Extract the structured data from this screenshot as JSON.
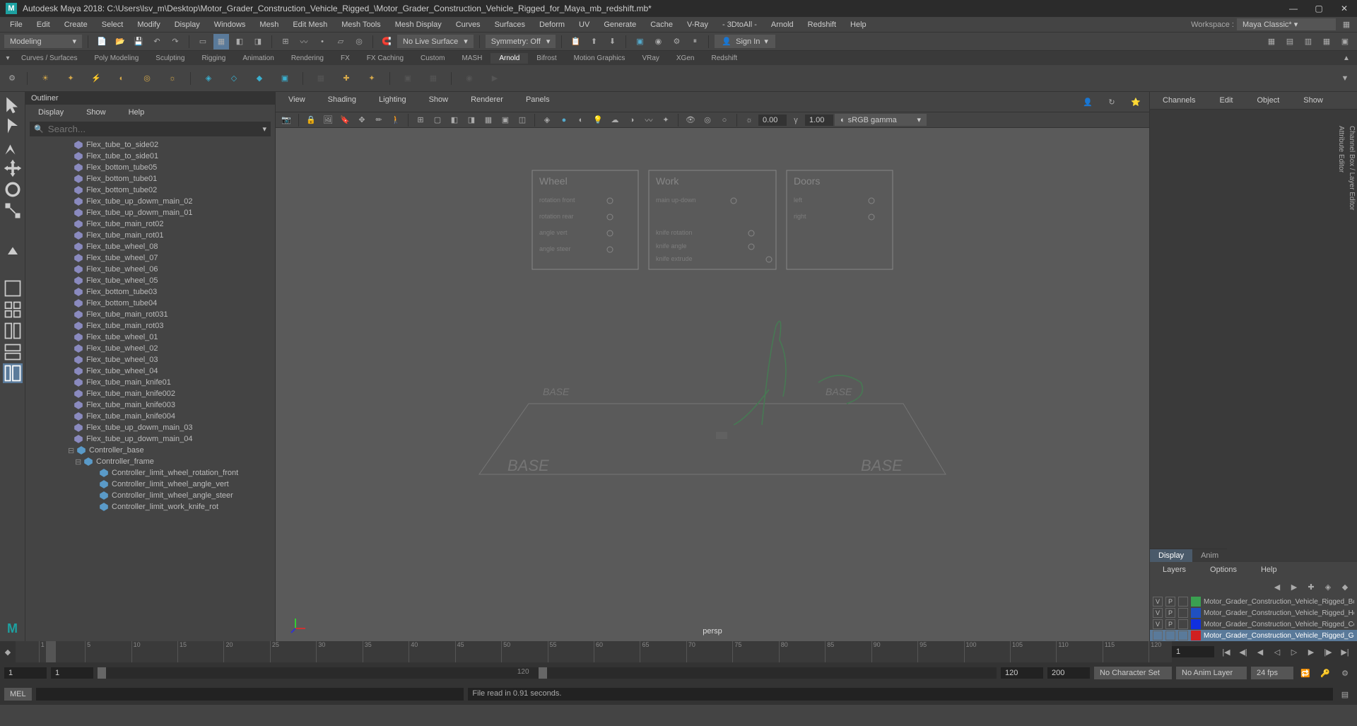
{
  "titlebar": {
    "icon_letter": "M",
    "title": "Autodesk Maya 2018: C:\\Users\\lsv_m\\Desktop\\Motor_Grader_Construction_Vehicle_Rigged_\\Motor_Grader_Construction_Vehicle_Rigged_for_Maya_mb_redshift.mb*"
  },
  "menubar": {
    "items": [
      "File",
      "Edit",
      "Create",
      "Select",
      "Modify",
      "Display",
      "Windows",
      "Mesh",
      "Edit Mesh",
      "Mesh Tools",
      "Mesh Display",
      "Curves",
      "Surfaces",
      "Deform",
      "UV",
      "Generate",
      "Cache",
      "V-Ray",
      "- 3DtoAll -",
      "Arnold",
      "Redshift",
      "Help"
    ],
    "workspace_label": "Workspace :",
    "workspace_value": "Maya Classic*"
  },
  "statusline": {
    "mode": "Modeling",
    "no_live_surface": "No Live Surface",
    "symmetry": "Symmetry: Off",
    "signin": "Sign In"
  },
  "shelf_tabs": [
    "Curves / Surfaces",
    "Poly Modeling",
    "Sculpting",
    "Rigging",
    "Animation",
    "Rendering",
    "FX",
    "FX Caching",
    "Custom",
    "MASH",
    "Arnold",
    "Bifrost",
    "Motion Graphics",
    "VRay",
    "XGen",
    "Redshift"
  ],
  "shelf_tabs_active": "Arnold",
  "outliner": {
    "title": "Outliner",
    "menu": [
      "Display",
      "Show",
      "Help"
    ],
    "search_placeholder": "Search...",
    "items": [
      {
        "name": "Flex_tube_to_side02",
        "indent": 1,
        "icon": "mesh"
      },
      {
        "name": "Flex_tube_to_side01",
        "indent": 1,
        "icon": "mesh"
      },
      {
        "name": "Flex_bottom_tube05",
        "indent": 1,
        "icon": "mesh"
      },
      {
        "name": "Flex_bottom_tube01",
        "indent": 1,
        "icon": "mesh"
      },
      {
        "name": "Flex_bottom_tube02",
        "indent": 1,
        "icon": "mesh"
      },
      {
        "name": "Flex_tube_up_dowm_main_02",
        "indent": 1,
        "icon": "mesh"
      },
      {
        "name": "Flex_tube_up_dowm_main_01",
        "indent": 1,
        "icon": "mesh"
      },
      {
        "name": "Flex_tube_main_rot02",
        "indent": 1,
        "icon": "mesh"
      },
      {
        "name": "Flex_tube_main_rot01",
        "indent": 1,
        "icon": "mesh"
      },
      {
        "name": "Flex_tube_wheel_08",
        "indent": 1,
        "icon": "mesh"
      },
      {
        "name": "Flex_tube_wheel_07",
        "indent": 1,
        "icon": "mesh"
      },
      {
        "name": "Flex_tube_wheel_06",
        "indent": 1,
        "icon": "mesh"
      },
      {
        "name": "Flex_tube_wheel_05",
        "indent": 1,
        "icon": "mesh"
      },
      {
        "name": "Flex_bottom_tube03",
        "indent": 1,
        "icon": "mesh"
      },
      {
        "name": "Flex_bottom_tube04",
        "indent": 1,
        "icon": "mesh"
      },
      {
        "name": "Flex_tube_main_rot031",
        "indent": 1,
        "icon": "mesh"
      },
      {
        "name": "Flex_tube_main_rot03",
        "indent": 1,
        "icon": "mesh"
      },
      {
        "name": "Flex_tube_wheel_01",
        "indent": 1,
        "icon": "mesh"
      },
      {
        "name": "Flex_tube_wheel_02",
        "indent": 1,
        "icon": "mesh"
      },
      {
        "name": "Flex_tube_wheel_03",
        "indent": 1,
        "icon": "mesh"
      },
      {
        "name": "Flex_tube_wheel_04",
        "indent": 1,
        "icon": "mesh"
      },
      {
        "name": "Flex_tube_main_knife01",
        "indent": 1,
        "icon": "mesh"
      },
      {
        "name": "Flex_tube_main_knife002",
        "indent": 1,
        "icon": "mesh"
      },
      {
        "name": "Flex_tube_main_knife003",
        "indent": 1,
        "icon": "mesh"
      },
      {
        "name": "Flex_tube_main_knife004",
        "indent": 1,
        "icon": "mesh"
      },
      {
        "name": "Flex_tube_up_dowm_main_03",
        "indent": 1,
        "icon": "mesh"
      },
      {
        "name": "Flex_tube_up_dowm_main_04",
        "indent": 1,
        "icon": "mesh"
      },
      {
        "name": "Controller_base",
        "indent": 0,
        "icon": "transform",
        "expanded": true
      },
      {
        "name": "Controller_frame",
        "indent": 2,
        "icon": "transform",
        "expanded": true
      },
      {
        "name": "Controller_limit_wheel_rotation_front",
        "indent": 3,
        "icon": "transform"
      },
      {
        "name": "Controller_limit_wheel_angle_vert",
        "indent": 3,
        "icon": "transform"
      },
      {
        "name": "Controller_limit_wheel_angle_steer",
        "indent": 3,
        "icon": "transform"
      },
      {
        "name": "Controller_limit_work_knife_rot",
        "indent": 3,
        "icon": "transform"
      }
    ]
  },
  "viewport": {
    "menu": [
      "View",
      "Shading",
      "Lighting",
      "Show",
      "Renderer",
      "Panels"
    ],
    "camera_label": "persp",
    "gamma_dropdown": "sRGB gamma",
    "field1": "0.00",
    "field2": "1.00"
  },
  "channels": {
    "tabs": [
      "Channels",
      "Edit",
      "Object",
      "Show"
    ]
  },
  "layers": {
    "display_tab": "Display",
    "anim_tab": "Anim",
    "menu": [
      "Layers",
      "Options",
      "Help"
    ],
    "rows": [
      {
        "v": "V",
        "p": "P",
        "color": "#3aa050",
        "name": "Motor_Grader_Construction_Vehicle_Rigged_Bones",
        "selected": false
      },
      {
        "v": "V",
        "p": "P",
        "color": "#2050c0",
        "name": "Motor_Grader_Construction_Vehicle_Rigged_Helpers",
        "selected": false
      },
      {
        "v": "V",
        "p": "P",
        "color": "#1030e0",
        "name": "Motor_Grader_Construction_Vehicle_Rigged_Controllers",
        "selected": false
      },
      {
        "v": "",
        "p": "",
        "color": "#d02020",
        "name": "Motor_Grader_Construction_Vehicle_Rigged_Geometry",
        "selected": true
      }
    ]
  },
  "vtabs": [
    "Channel Box / Layer Editor",
    "Attribute Editor"
  ],
  "timeline": {
    "ticks": [
      1,
      5,
      10,
      15,
      20,
      25,
      30,
      35,
      40,
      45,
      50,
      55,
      60,
      65,
      70,
      75,
      80,
      85,
      90,
      95,
      100,
      105,
      110,
      115,
      120
    ],
    "current": 1,
    "current_field": "1"
  },
  "range": {
    "start": "1",
    "inner_start": "1",
    "end": "120",
    "inner_end": "200",
    "charset": "No Character Set",
    "animlayer": "No Anim Layer",
    "fps": "24 fps"
  },
  "command": {
    "label": "MEL",
    "output": "File read in  0.91 seconds."
  }
}
